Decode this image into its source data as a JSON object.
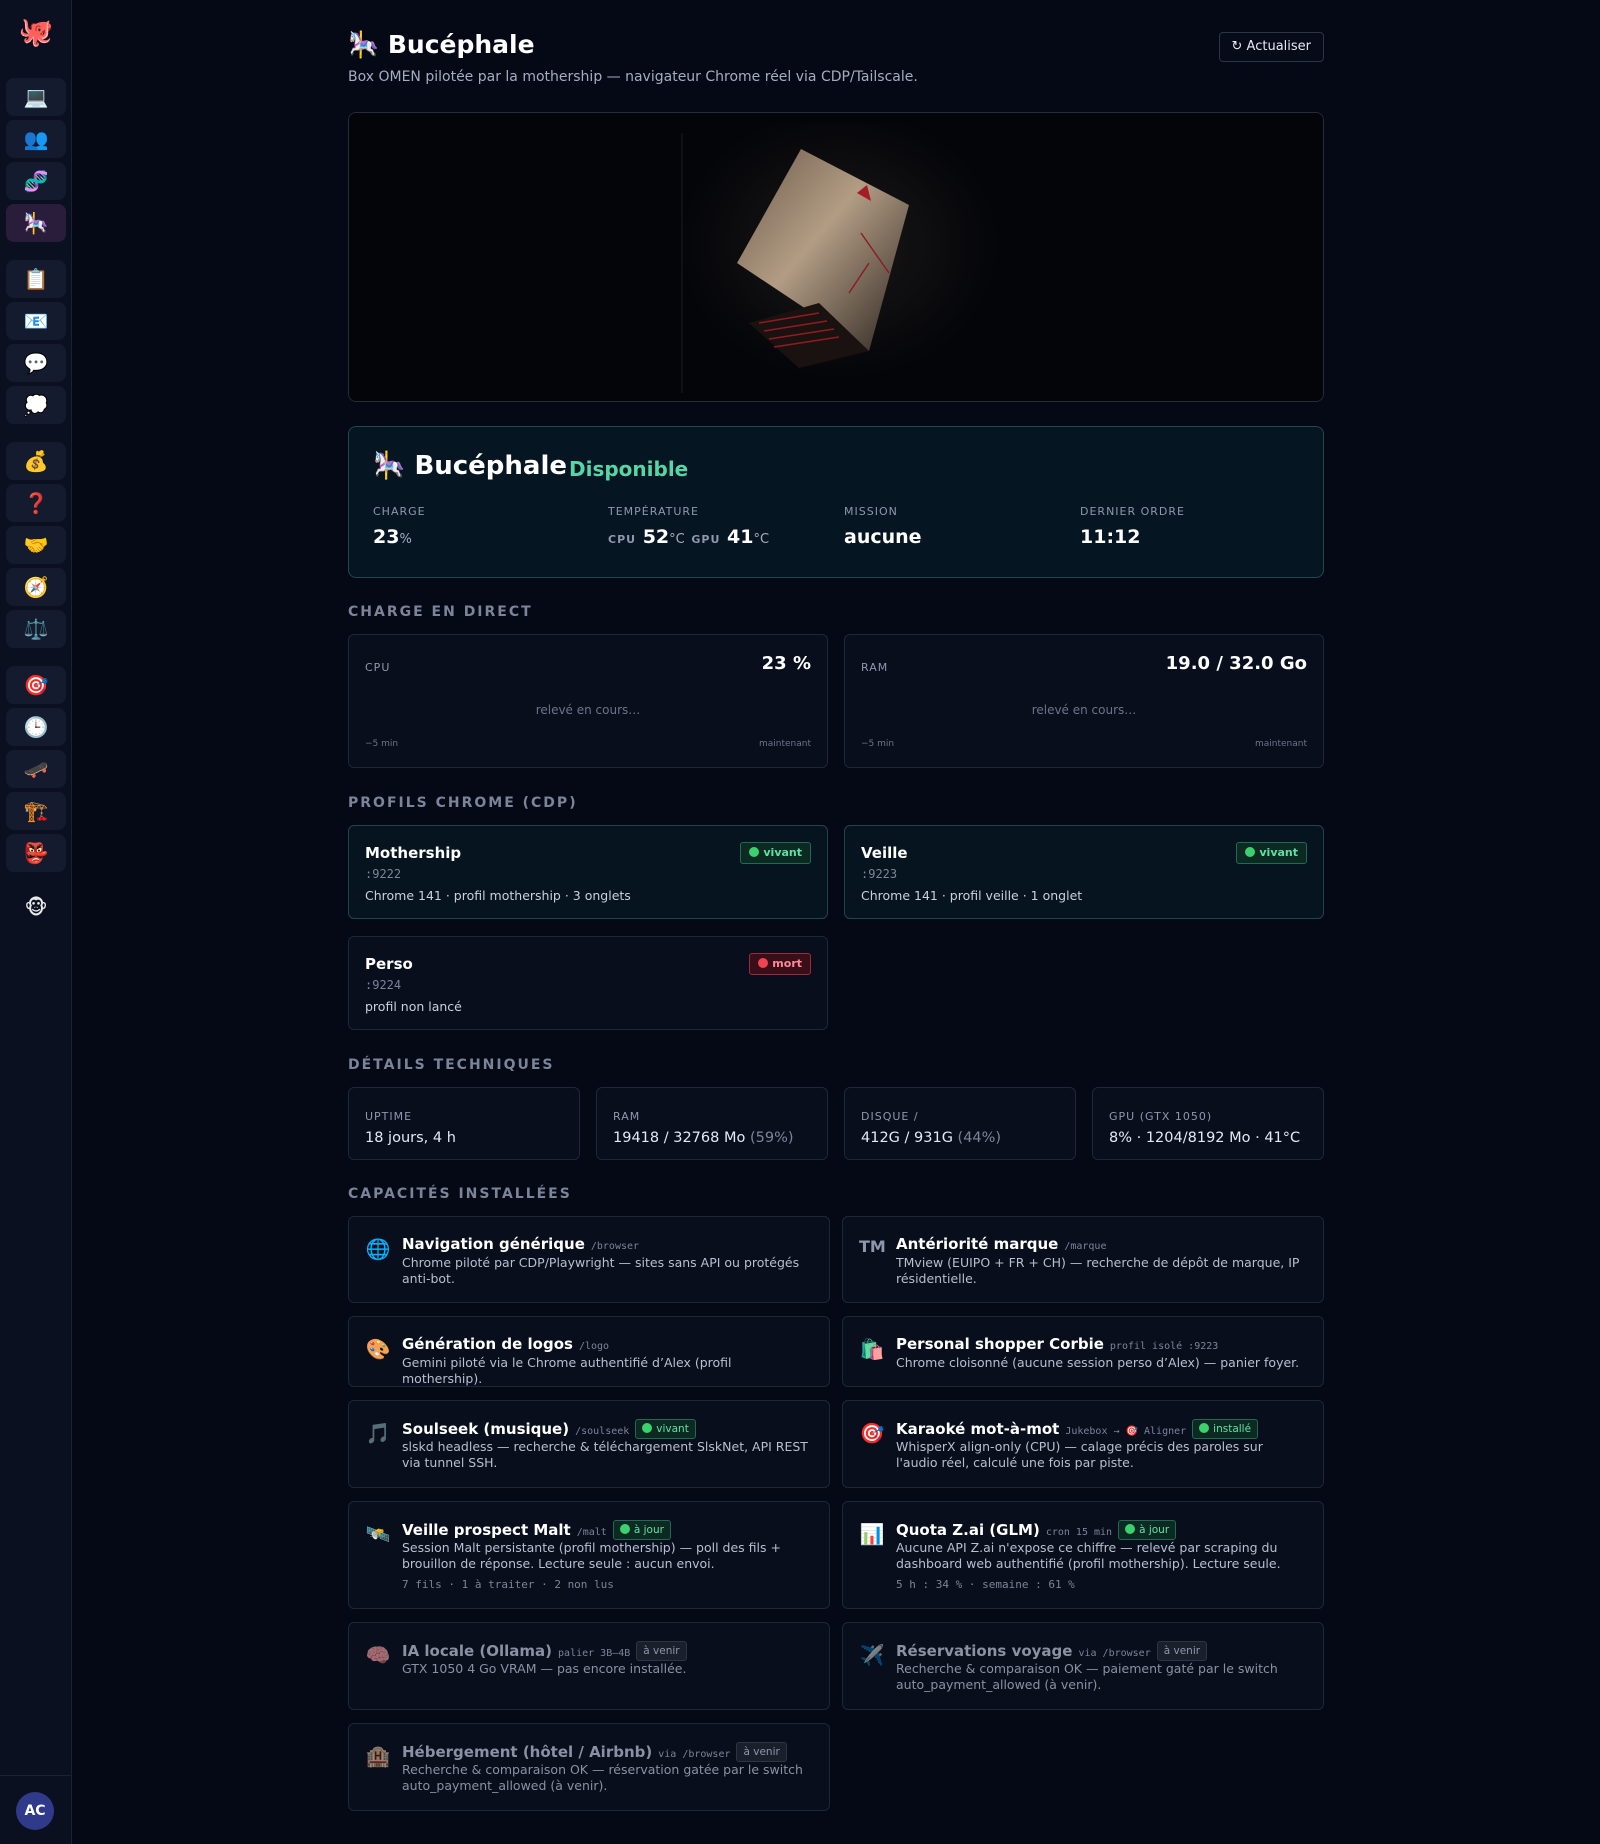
{
  "sidebar": {
    "logo_icon": "🐙",
    "items": [
      {
        "icon": "💻",
        "name": "laptop-icon"
      },
      {
        "icon": "👥",
        "name": "users-icon"
      },
      {
        "icon": "🧬",
        "name": "dna-icon"
      },
      {
        "icon": "🎠",
        "name": "carousel-horse-icon",
        "active": true
      },
      {
        "icon": "📋",
        "name": "clipboard-icon"
      },
      {
        "icon": "📧",
        "name": "email-icon"
      },
      {
        "icon": "💬",
        "name": "speech-bubble-icon"
      },
      {
        "icon": "💭",
        "name": "thought-bubble-icon"
      },
      {
        "icon": "💰",
        "name": "money-bag-icon"
      },
      {
        "icon": "❓",
        "name": "question-icon"
      },
      {
        "icon": "🤝",
        "name": "handshake-icon"
      },
      {
        "icon": "🧭",
        "name": "compass-icon"
      },
      {
        "icon": "⚖️",
        "name": "scales-icon"
      },
      {
        "icon": "🎯",
        "name": "target-icon"
      },
      {
        "icon": "🕒",
        "name": "clock-icon"
      },
      {
        "icon": "🛹",
        "name": "skateboard-icon"
      },
      {
        "icon": "🏗️",
        "name": "crane-icon"
      },
      {
        "icon": "👺",
        "name": "goblin-mask-icon"
      },
      {
        "icon": "🐵",
        "name": "monkey-icon"
      }
    ],
    "avatar": "AC"
  },
  "header": {
    "icon": "🎠",
    "title": "Bucéphale",
    "subtitle": "Box OMEN pilotée par la mothership — navigateur Chrome réel via CDP/Tailscale.",
    "refresh_label": "↻ Actualiser"
  },
  "status": {
    "icon": "🎠",
    "name": "Bucéphale",
    "state": "Disponible",
    "charge_label": "CHARGE",
    "charge_value": "23",
    "charge_unit": "%",
    "temp_label": "TEMPÉRATURE",
    "cpu_tag": "CPU",
    "cpu_temp": "52",
    "gpu_tag": "GPU",
    "gpu_temp": "41",
    "temp_unit": "°C",
    "mission_label": "MISSION",
    "mission_value": "aucune",
    "last_order_label": "DERNIER ORDRE",
    "last_order_value": "11:12"
  },
  "live": {
    "section_title": "CHARGE EN DIRECT",
    "cpu": {
      "label": "CPU",
      "value": "23 %",
      "status": "relevé en cours…",
      "axis_start": "−5 min",
      "axis_end": "maintenant"
    },
    "ram": {
      "label": "RAM",
      "value": "19.0 / 32.0 Go",
      "status": "relevé en cours…",
      "axis_start": "−5 min",
      "axis_end": "maintenant"
    }
  },
  "profiles": {
    "section_title": "PROFILS CHROME (CDP)",
    "items": [
      {
        "name": "Mothership",
        "port": ":9222",
        "desc": "Chrome 141 · profil mothership · 3 onglets",
        "status": "vivant"
      },
      {
        "name": "Veille",
        "port": ":9223",
        "desc": "Chrome 141 · profil veille · 1 onglet",
        "status": "vivant"
      },
      {
        "name": "Perso",
        "port": ":9224",
        "desc": "profil non lancé",
        "status": "mort"
      }
    ]
  },
  "tech": {
    "section_title": "DÉTAILS TECHNIQUES",
    "items": [
      {
        "label": "UPTIME",
        "value": "18 jours, 4 h",
        "extra": ""
      },
      {
        "label": "RAM",
        "value": "19418 / 32768 Mo ",
        "extra": "(59%)"
      },
      {
        "label": "DISQUE /",
        "value": "412G / 931G ",
        "extra": "(44%)"
      },
      {
        "label": "GPU (GTX 1050)",
        "value": "8% · 1204/8192 Mo · 41°C",
        "extra": ""
      }
    ]
  },
  "capabilities": {
    "section_title": "CAPACITÉS INSTALLÉES",
    "items": [
      {
        "icon": "🌐",
        "title": "Navigation générique",
        "code": "/browser",
        "state": "",
        "desc": "Chrome piloté par CDP/Playwright — sites sans API ou protégés anti-bot.",
        "meta": ""
      },
      {
        "icon": "™",
        "title": "Antériorité marque",
        "code": "/marque",
        "state": "",
        "desc": "TMview (EUIPO + FR + CH) — recherche de dépôt de marque, IP résidentielle.",
        "meta": ""
      },
      {
        "icon": "🎨",
        "title": "Génération de logos",
        "code": "/logo",
        "state": "",
        "desc": "Gemini piloté via le Chrome authentifié d’Alex (profil mothership).",
        "meta": ""
      },
      {
        "icon": "🛍️",
        "title": "Personal shopper Corbie",
        "code": "profil isolé :9223",
        "state": "",
        "desc": "Chrome cloisonné (aucune session perso d’Alex) — panier foyer.",
        "meta": ""
      },
      {
        "icon": "🎵",
        "title": "Soulseek (musique)",
        "code": "/soulseek",
        "state": "vivant",
        "desc": "slskd headless — recherche & téléchargement SlskNet, API REST via tunnel SSH.",
        "meta": ""
      },
      {
        "icon": "🎯",
        "title": "Karaoké mot-à-mot",
        "code": "Jukebox → 🎯 Aligner",
        "state": "installé",
        "desc": "WhisperX align-only (CPU) — calage précis des paroles sur l'audio réel, calculé une fois par piste.",
        "meta": ""
      },
      {
        "icon": "🛰️",
        "title": "Veille prospect Malt",
        "code": "/malt",
        "state": "à jour",
        "desc": "Session Malt persistante (profil mothership) — poll des fils + brouillon de réponse. Lecture seule : aucun envoi.",
        "meta": "7 fils · 1 à traiter · 2 non lus"
      },
      {
        "icon": "📊",
        "title": "Quota Z.ai (GLM)",
        "code": "cron 15 min",
        "state": "à jour",
        "desc": "Aucune API Z.ai n'expose ce chiffre — relevé par scraping du dashboard web authentifié (profil mothership). Lecture seule.",
        "meta": "5 h : 34 % · semaine : 61 %"
      },
      {
        "icon": "🧠",
        "title": "IA locale (Ollama)",
        "code": "palier 3B–4B",
        "state": "à venir",
        "desc": "GTX 1050 4 Go VRAM — pas encore installée.",
        "meta": ""
      },
      {
        "icon": "✈️",
        "title": "Réservations voyage",
        "code": "via /browser",
        "state": "à venir",
        "desc": "Recherche & comparaison OK — paiement gaté par le switch auto_payment_allowed (à venir).",
        "meta": ""
      },
      {
        "icon": "🏨",
        "title": "Hébergement (hôtel / Airbnb)",
        "code": "via /browser",
        "state": "à venir",
        "desc": "Recherche & comparaison OK — réservation gatée par le switch auto_payment_allowed (à venir).",
        "meta": ""
      }
    ]
  }
}
